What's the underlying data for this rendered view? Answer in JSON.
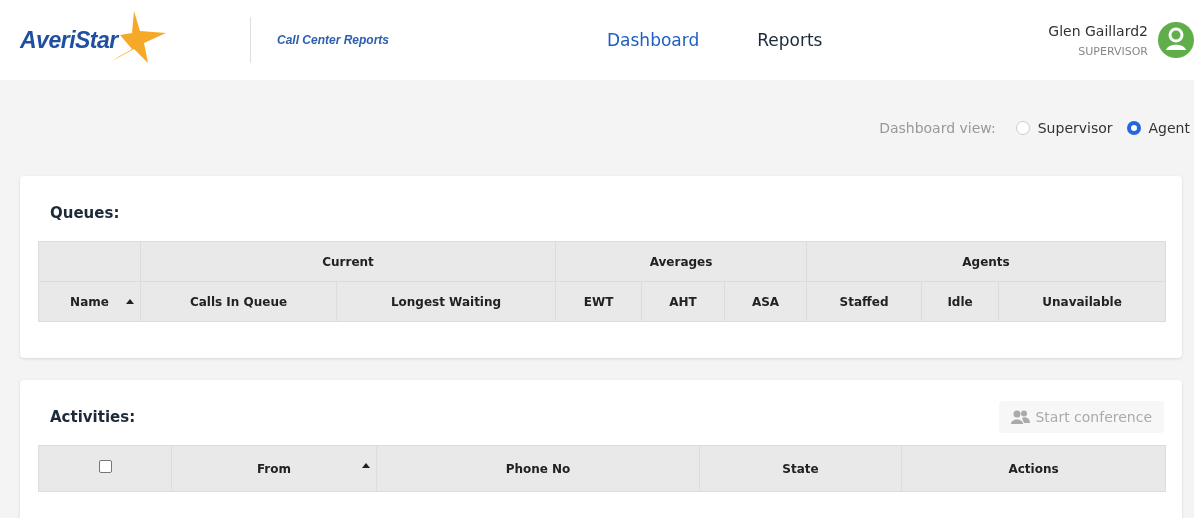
{
  "header": {
    "logo_text": "AveriStar",
    "app_title": "Call Center Reports",
    "nav": [
      {
        "label": "Dashboard",
        "selected": true
      },
      {
        "label": "Reports",
        "selected": false
      }
    ],
    "user": {
      "name": "Glen Gaillard2",
      "role": "SUPERVISOR"
    }
  },
  "view_switch": {
    "label": "Dashboard view:",
    "options": [
      {
        "label": "Supervisor",
        "selected": false
      },
      {
        "label": "Agent",
        "selected": true
      }
    ]
  },
  "queues": {
    "title": "Queues:",
    "columns": [
      {
        "label": "Name",
        "sorted": true
      }
    ],
    "groups": [
      {
        "label": "Current",
        "columns": [
          {
            "label": "Calls In Queue"
          },
          {
            "label": "Longest Waiting"
          }
        ]
      },
      {
        "label": "Averages",
        "columns": [
          {
            "label": "EWT"
          },
          {
            "label": "AHT"
          },
          {
            "label": "ASA"
          }
        ]
      },
      {
        "label": "Agents",
        "columns": [
          {
            "label": "Staffed"
          },
          {
            "label": "Idle"
          },
          {
            "label": "Unavailable"
          }
        ]
      }
    ]
  },
  "activities": {
    "title": "Activities:",
    "conference_button": {
      "label": "Start conference",
      "disabled": true
    },
    "select_all": {
      "checked": false
    },
    "columns": [
      {
        "label": "From",
        "sorted": true
      },
      {
        "label": "Phone No"
      },
      {
        "label": "State"
      },
      {
        "label": "Actions"
      }
    ]
  }
}
